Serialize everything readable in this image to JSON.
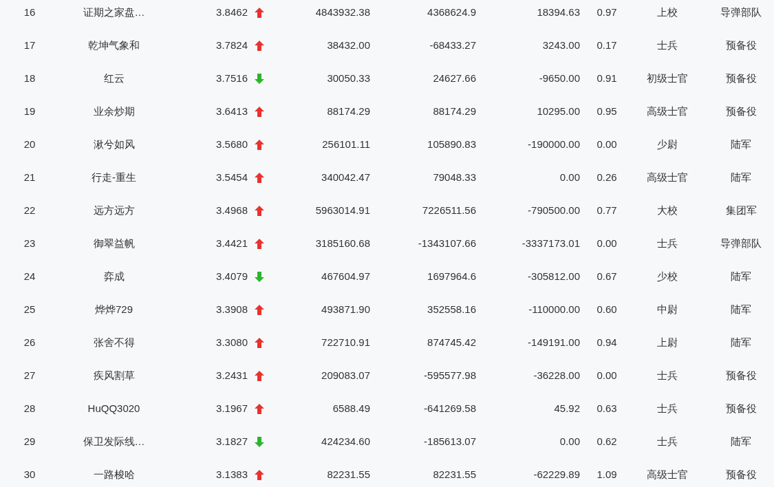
{
  "rows": [
    {
      "rank": "16",
      "name": "证期之家盘…",
      "score": "3.8462",
      "kind": "up",
      "column_4": "4843932.38",
      "column_5": "4368624.9",
      "column_6": "18394.63",
      "column_7": "0.97",
      "rank_title": "上校",
      "unit": "导弹部队"
    },
    {
      "rank": "17",
      "name": "乾坤气象和",
      "score": "3.7824",
      "kind": "up",
      "column_4": "38432.00",
      "column_5": "-68433.27",
      "column_6": "3243.00",
      "column_7": "0.17",
      "rank_title": "士兵",
      "unit": "预备役"
    },
    {
      "rank": "18",
      "name": "红云",
      "score": "3.7516",
      "kind": "down",
      "column_4": "30050.33",
      "column_5": "24627.66",
      "column_6": "-9650.00",
      "column_7": "0.91",
      "rank_title": "初级士官",
      "unit": "预备役"
    },
    {
      "rank": "19",
      "name": "业余炒期",
      "score": "3.6413",
      "kind": "up",
      "column_4": "88174.29",
      "column_5": "88174.29",
      "column_6": "10295.00",
      "column_7": "0.95",
      "rank_title": "高级士官",
      "unit": "预备役"
    },
    {
      "rank": "20",
      "name": "湫兮如风",
      "score": "3.5680",
      "kind": "up",
      "column_4": "256101.11",
      "column_5": "105890.83",
      "column_6": "-190000.00",
      "column_7": "0.00",
      "rank_title": "少尉",
      "unit": "陆军"
    },
    {
      "rank": "21",
      "name": "行走-重生",
      "score": "3.5454",
      "kind": "up",
      "column_4": "340042.47",
      "column_5": "79048.33",
      "column_6": "0.00",
      "column_7": "0.26",
      "rank_title": "高级士官",
      "unit": "陆军"
    },
    {
      "rank": "22",
      "name": "远方远方",
      "score": "3.4968",
      "kind": "up",
      "column_4": "5963014.91",
      "column_5": "7226511.56",
      "column_6": "-790500.00",
      "column_7": "0.77",
      "rank_title": "大校",
      "unit": "集团军"
    },
    {
      "rank": "23",
      "name": "御翠益帆",
      "score": "3.4421",
      "kind": "up",
      "column_4": "3185160.68",
      "column_5": "-1343107.66",
      "column_6": "-3337173.01",
      "column_7": "0.00",
      "rank_title": "士兵",
      "unit": "导弹部队"
    },
    {
      "rank": "24",
      "name": "弈成",
      "score": "3.4079",
      "kind": "down",
      "column_4": "467604.97",
      "column_5": "1697964.6",
      "column_6": "-305812.00",
      "column_7": "0.67",
      "rank_title": "少校",
      "unit": "陆军"
    },
    {
      "rank": "25",
      "name": "烨烨729",
      "score": "3.3908",
      "kind": "up",
      "column_4": "493871.90",
      "column_5": "352558.16",
      "column_6": "-110000.00",
      "column_7": "0.60",
      "rank_title": "中尉",
      "unit": "陆军"
    },
    {
      "rank": "26",
      "name": "张舍不得",
      "score": "3.3080",
      "kind": "up",
      "column_4": "722710.91",
      "column_5": "874745.42",
      "column_6": "-149191.00",
      "column_7": "0.94",
      "rank_title": "上尉",
      "unit": "陆军"
    },
    {
      "rank": "27",
      "name": "疾风割草",
      "score": "3.2431",
      "kind": "up",
      "column_4": "209083.07",
      "column_5": "-595577.98",
      "column_6": "-36228.00",
      "column_7": "0.00",
      "rank_title": "士兵",
      "unit": "预备役"
    },
    {
      "rank": "28",
      "name": "HuQQ3020",
      "score": "3.1967",
      "kind": "up",
      "column_4": "6588.49",
      "column_5": "-641269.58",
      "column_6": "45.92",
      "column_7": "0.63",
      "rank_title": "士兵",
      "unit": "预备役"
    },
    {
      "rank": "29",
      "name": "保卫发际线…",
      "score": "3.1827",
      "kind": "down",
      "column_4": "424234.60",
      "column_5": "-185613.07",
      "column_6": "0.00",
      "column_7": "0.62",
      "rank_title": "士兵",
      "unit": "陆军"
    },
    {
      "rank": "30",
      "name": "一路梭哈",
      "score": "3.1383",
      "kind": "up",
      "column_4": "82231.55",
      "column_5": "82231.55",
      "column_6": "-62229.89",
      "column_7": "1.09",
      "rank_title": "高级士官",
      "unit": "预备役"
    }
  ]
}
